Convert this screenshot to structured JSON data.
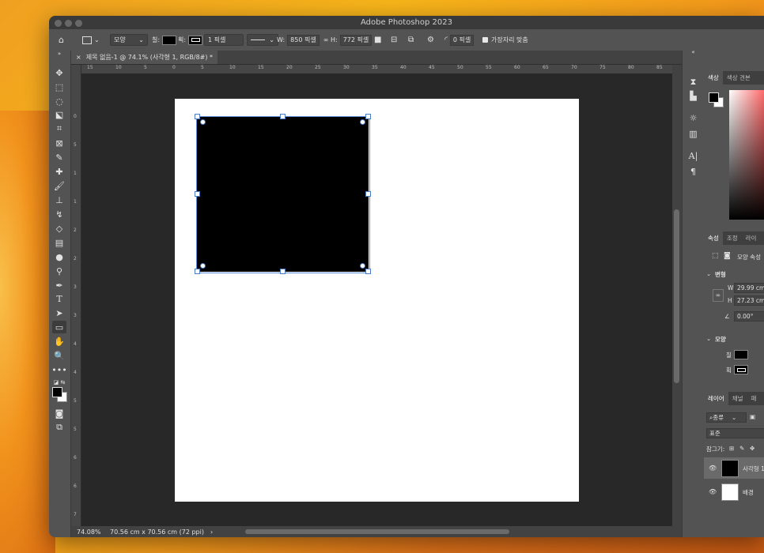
{
  "app": {
    "title": "Adobe Photoshop 2023"
  },
  "options_bar": {
    "mode": "모양",
    "fill_label": "칠:",
    "stroke_label": "획:",
    "stroke_width": "1 픽셀",
    "w_label": "W:",
    "w_value": "850 픽셀",
    "h_label": "H:",
    "h_value": "772 픽셀",
    "radius_value": "0 픽셀",
    "align_edges_label": "가장자리 맞춤"
  },
  "document": {
    "tab_title": "제목 없음-1 @ 74.1% (사각형 1, RGB/8#) *",
    "canvas_color": "#ffffff",
    "shape_color": "#000000"
  },
  "rulers": {
    "h_ticks": [
      "15",
      "10",
      "5",
      "0",
      "5",
      "10",
      "15",
      "20",
      "25",
      "30",
      "35",
      "40",
      "45",
      "50",
      "55",
      "60",
      "65",
      "70",
      "75",
      "80",
      "85"
    ],
    "v_ticks": [
      "0",
      "5",
      "1",
      "1",
      "2",
      "2",
      "3",
      "3",
      "4",
      "4",
      "5",
      "5",
      "6",
      "6",
      "7"
    ]
  },
  "status": {
    "zoom": "74.08%",
    "doc_info": "70.56 cm x 70.56 cm (72 ppi)",
    "arrow": "›"
  },
  "color_panel": {
    "tabs": [
      "색상",
      "색상 견본"
    ]
  },
  "properties_panel": {
    "tabs": [
      "속성",
      "조정",
      "라이"
    ],
    "kind": "모양 속성",
    "transform_header": "변형",
    "w_label": "W",
    "w_value": "29.99 cm",
    "h_label": "H",
    "h_value": "27.23 cm",
    "angle_value": "0.00°",
    "appearance_header": "모양",
    "fill_label": "칠",
    "stroke_label": "획"
  },
  "layers_panel": {
    "tabs": [
      "레이어",
      "채널",
      "패"
    ],
    "filter": "종류",
    "blend": "표준",
    "lock_label": "잠그기:",
    "layers": [
      {
        "name": "사각형 1",
        "selected": true
      },
      {
        "name": "배경",
        "selected": false
      }
    ]
  },
  "colors": {
    "accent": "#5a8fd8",
    "ui_bg": "#535353",
    "pasteboard": "#282828"
  }
}
